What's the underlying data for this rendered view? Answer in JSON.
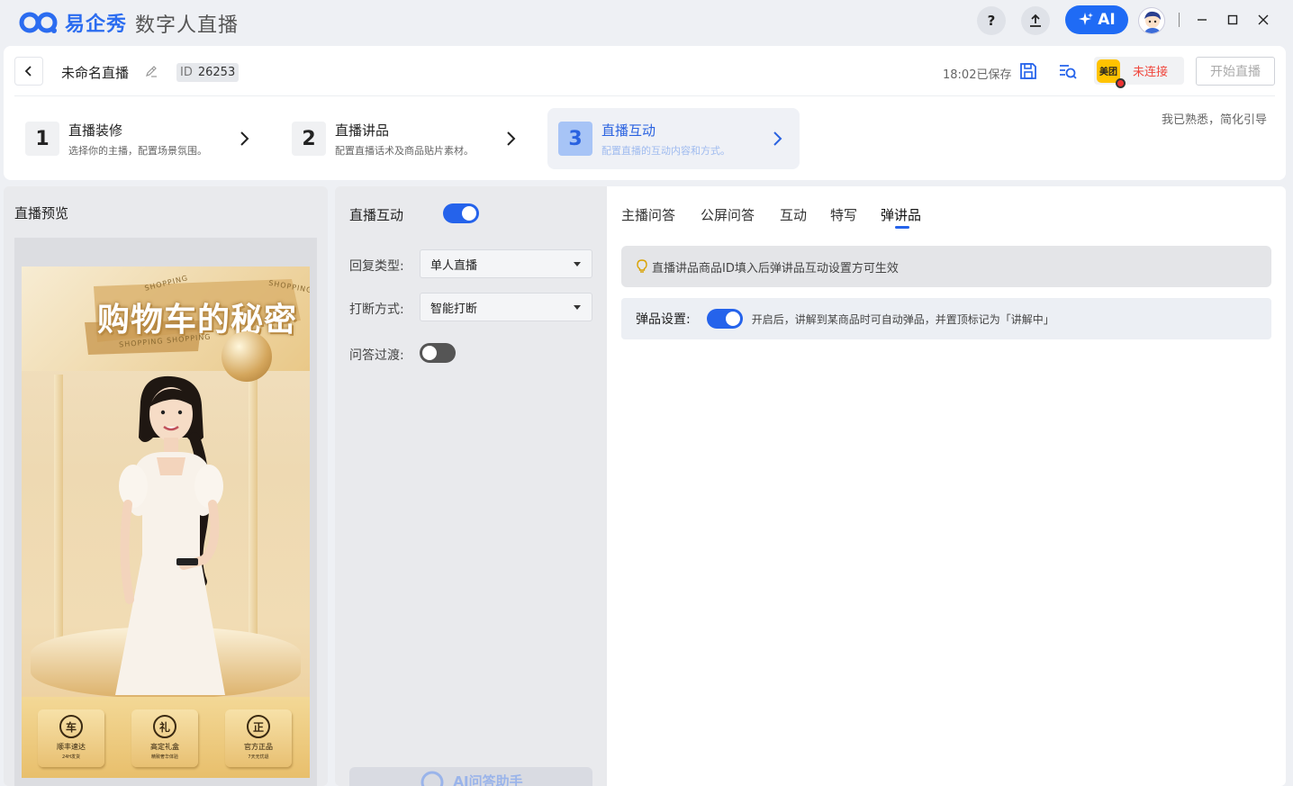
{
  "app": {
    "logo_text": "易企秀",
    "subtitle": "数字人直播"
  },
  "titlebar": {
    "help_label": "?",
    "ai_label": "AI"
  },
  "header": {
    "project_name": "未命名直播",
    "id_key": "ID",
    "id_value": "26253",
    "saved_text": "18:02已保存",
    "platform_logo": "美团",
    "platform_status": "未连接",
    "start_button": "开始直播",
    "skip_guide": "我已熟悉，简化引导"
  },
  "steps": [
    {
      "num": "1",
      "title": "直播装修",
      "desc": "选择你的主播，配置场景氛围。"
    },
    {
      "num": "2",
      "title": "直播讲品",
      "desc": "配置直播话术及商品贴片素材。"
    },
    {
      "num": "3",
      "title": "直播互动",
      "desc": "配置直播的互动内容和方式。"
    }
  ],
  "preview": {
    "title": "直播预览",
    "banner_title": "购物车的秘密",
    "tag1": "SHOPPING",
    "tag2": "SHOPPING",
    "tag3": "SHOPPING  SHOPPING",
    "features": [
      {
        "icon": "车",
        "title": "顺丰速达",
        "sub": "24H发货"
      },
      {
        "icon": "礼",
        "title": "高定礼盒",
        "sub": "精致奢华体验"
      },
      {
        "icon": "正",
        "title": "官方正品",
        "sub": "7天无忧退"
      }
    ]
  },
  "settings": {
    "title": "直播互动",
    "interaction_enabled": true,
    "reply_type_label": "回复类型:",
    "reply_type_value": "单人直播",
    "interrupt_label": "打断方式:",
    "interrupt_value": "智能打断",
    "transition_label": "问答过渡:",
    "transition_enabled": false,
    "ai_qa_label": "AI问答助手"
  },
  "tabs": [
    {
      "label": "主播问答"
    },
    {
      "label": "公屏问答"
    },
    {
      "label": "互动"
    },
    {
      "label": "特写"
    },
    {
      "label": "弹讲品"
    }
  ],
  "content": {
    "tip": "直播讲品商品ID填入后弹讲品互动设置方可生效",
    "popup_label": "弹品设置:",
    "popup_enabled": true,
    "popup_desc": "开启后，讲解到某商品时可自动弹品，并置顶标记为「讲解中」"
  },
  "colors": {
    "accent": "#2563eb",
    "danger": "#f0463c",
    "meituan": "#ffc300"
  }
}
